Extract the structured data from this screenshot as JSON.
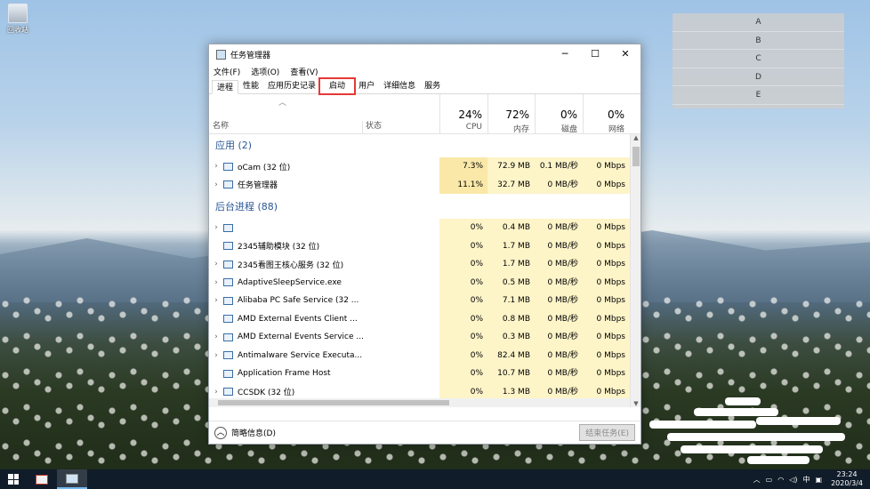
{
  "desktop": {
    "recycle_bin_label": "回收站",
    "overlay_labels": [
      "A",
      "B",
      "C",
      "D",
      "E"
    ]
  },
  "window": {
    "title": "任务管理器",
    "controls": {
      "minimize": "─",
      "maximize": "☐",
      "close": "✕"
    },
    "menu": [
      "文件(F)",
      "选项(O)",
      "查看(V)"
    ],
    "tabs": [
      "进程",
      "性能",
      "应用历史记录",
      "启动",
      "用户",
      "详细信息",
      "服务"
    ],
    "active_tab": "进程",
    "highlighted_tab": "启动",
    "columns": {
      "name": "名称",
      "status": "状态",
      "cpu": {
        "pct": "24%",
        "label": "CPU"
      },
      "memory": {
        "pct": "72%",
        "label": "内存"
      },
      "disk": {
        "pct": "0%",
        "label": "磁盘"
      },
      "network": {
        "pct": "0%",
        "label": "网络"
      }
    },
    "groups": {
      "apps": "应用 (2)",
      "background": "后台进程 (88)"
    },
    "apps": [
      {
        "name": "oCam (32 位)",
        "expandable": true,
        "cpu": "7.3%",
        "mem": "72.9 MB",
        "disk": "0.1 MB/秒",
        "net": "0 Mbps"
      },
      {
        "name": "任务管理器",
        "expandable": true,
        "cpu": "11.1%",
        "mem": "32.7 MB",
        "disk": "0 MB/秒",
        "net": "0 Mbps"
      }
    ],
    "background": [
      {
        "name": "",
        "expandable": true,
        "cpu": "0%",
        "mem": "0.4 MB",
        "disk": "0 MB/秒",
        "net": "0 Mbps"
      },
      {
        "name": "2345辅助模块 (32 位)",
        "expandable": false,
        "cpu": "0%",
        "mem": "1.7 MB",
        "disk": "0 MB/秒",
        "net": "0 Mbps"
      },
      {
        "name": "2345看图王核心服务 (32 位)",
        "expandable": true,
        "cpu": "0%",
        "mem": "1.7 MB",
        "disk": "0 MB/秒",
        "net": "0 Mbps"
      },
      {
        "name": "AdaptiveSleepService.exe",
        "expandable": true,
        "cpu": "0%",
        "mem": "0.5 MB",
        "disk": "0 MB/秒",
        "net": "0 Mbps"
      },
      {
        "name": "Alibaba PC Safe Service (32 ...",
        "expandable": true,
        "cpu": "0%",
        "mem": "7.1 MB",
        "disk": "0 MB/秒",
        "net": "0 Mbps"
      },
      {
        "name": "AMD External Events Client ...",
        "expandable": false,
        "cpu": "0%",
        "mem": "0.8 MB",
        "disk": "0 MB/秒",
        "net": "0 Mbps"
      },
      {
        "name": "AMD External Events Service ...",
        "expandable": true,
        "cpu": "0%",
        "mem": "0.3 MB",
        "disk": "0 MB/秒",
        "net": "0 Mbps"
      },
      {
        "name": "Antimalware Service Executa...",
        "expandable": true,
        "cpu": "0%",
        "mem": "82.4 MB",
        "disk": "0 MB/秒",
        "net": "0 Mbps"
      },
      {
        "name": "Application Frame Host",
        "expandable": false,
        "cpu": "0%",
        "mem": "10.7 MB",
        "disk": "0 MB/秒",
        "net": "0 Mbps"
      },
      {
        "name": "CCSDK (32 位)",
        "expandable": true,
        "cpu": "0%",
        "mem": "1.3 MB",
        "disk": "0 MB/秒",
        "net": "0 Mbps"
      }
    ],
    "footer": {
      "fewer_details": "简略信息(D)",
      "end_task": "结束任务(E)"
    }
  },
  "taskbar": {
    "tray": {
      "ime": "中",
      "time": "23:24",
      "date": "2020/3/4"
    }
  },
  "colors": {
    "group_heading": "#2b5797",
    "highlight_box": "#e53935",
    "cpu_strong": "#f9e8a8",
    "cpu_light": "#fdf4c8"
  }
}
